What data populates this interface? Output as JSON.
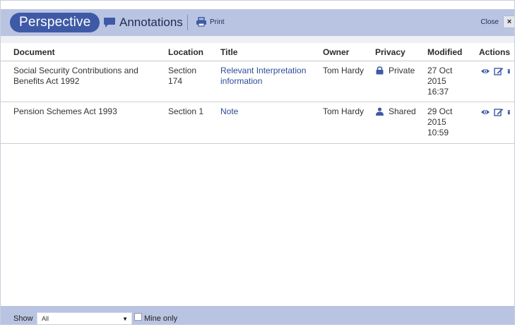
{
  "header": {
    "perspective_label": "Perspective",
    "annotations_label": "Annotations",
    "print_label": "Print",
    "close_label": "Close",
    "close_glyph": "×",
    "colors": {
      "bar": "#b9c4e2",
      "pill": "#3e5aa6"
    }
  },
  "table": {
    "columns": [
      "Document",
      "Location",
      "Title",
      "Owner",
      "Privacy",
      "Modified",
      "Actions"
    ],
    "rows": [
      {
        "document": "Social Security Contributions and Benefits Act 1992",
        "location": "Section 174",
        "title": "Relevant Interpretation information",
        "owner": "Tom Hardy",
        "privacy": "Private",
        "privacy_icon": "lock-icon",
        "modified": "27 Oct 2015 16:37",
        "actions": [
          "view-icon",
          "edit-icon",
          "delete-icon"
        ]
      },
      {
        "document": "Pension Schemes Act 1993",
        "location": "Section 1",
        "title": "Note",
        "owner": "Tom Hardy",
        "privacy": "Shared",
        "privacy_icon": "user-icon",
        "modified": "29 Oct 2015 10:59",
        "actions": [
          "view-icon",
          "edit-icon",
          "delete-icon"
        ]
      }
    ]
  },
  "footer": {
    "show_label": "Show",
    "show_value": "All",
    "mine_only_label": "Mine only",
    "mine_only_checked": false
  }
}
